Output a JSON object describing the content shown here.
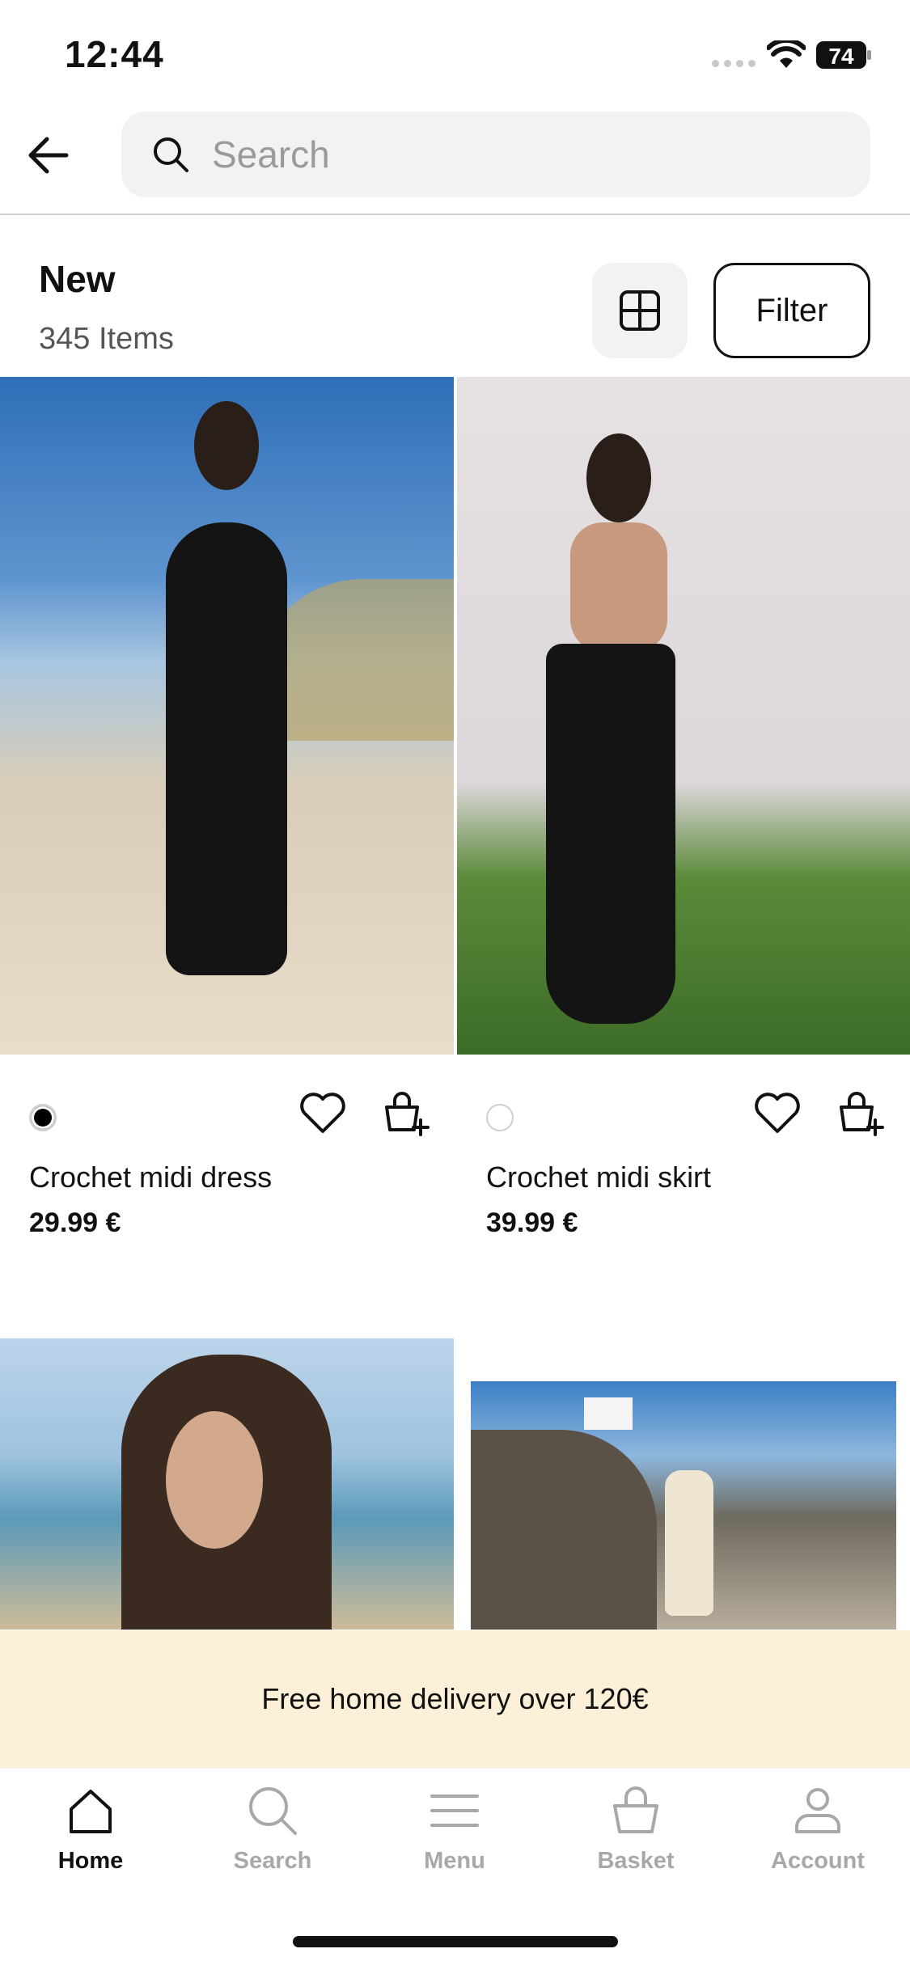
{
  "status_bar": {
    "time": "12:44",
    "battery": "74"
  },
  "search": {
    "placeholder": "Search"
  },
  "heading": {
    "title": "New",
    "count": "345 Items",
    "filter_label": "Filter"
  },
  "products": [
    {
      "name": "Crochet midi dress",
      "price": "29.99 €",
      "swatch": "#000000"
    },
    {
      "name": "Crochet midi skirt",
      "price": "39.99 €",
      "swatch": "#ffffff"
    }
  ],
  "promo": {
    "text": "Free home delivery over 120€",
    "background": "#fdf0d8"
  },
  "nav": {
    "items": [
      {
        "label": "Home",
        "icon": "home-icon",
        "active": true
      },
      {
        "label": "Search",
        "icon": "search-icon",
        "active": false
      },
      {
        "label": "Menu",
        "icon": "menu-icon",
        "active": false
      },
      {
        "label": "Basket",
        "icon": "basket-icon",
        "active": false
      },
      {
        "label": "Account",
        "icon": "account-icon",
        "active": false
      }
    ]
  },
  "colors": {
    "text": "#111111",
    "muted": "#a8a8a8",
    "search_bg": "#f2f2f2"
  }
}
